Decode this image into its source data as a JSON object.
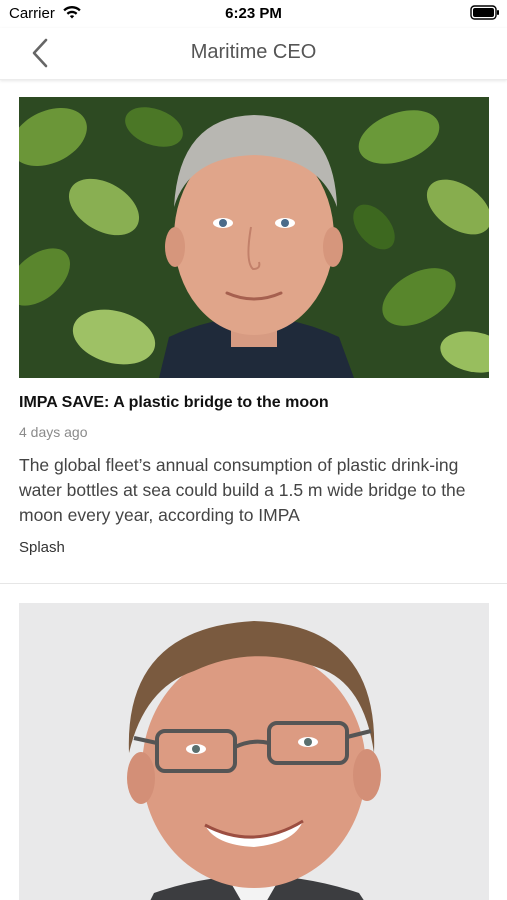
{
  "status_bar": {
    "carrier": "Carrier",
    "time": "6:23 PM"
  },
  "nav": {
    "title": "Maritime CEO",
    "back_icon": "chevron-left-icon"
  },
  "articles": [
    {
      "headline": "IMPA SAVE: A plastic bridge to the moon",
      "date": "4 days ago",
      "summary": "The global fleet’s annual consumption of plastic drink-ing water bottles at sea could build a 1.5 m wide bridge to the moon every year, according to IMPA",
      "source": "Splash",
      "image": "portrait-man-with-plant-background"
    },
    {
      "image": "portrait-man-with-glasses"
    }
  ],
  "colors": {
    "nav_title": "#555555",
    "date": "#8a8a8a",
    "summary": "#444444"
  }
}
